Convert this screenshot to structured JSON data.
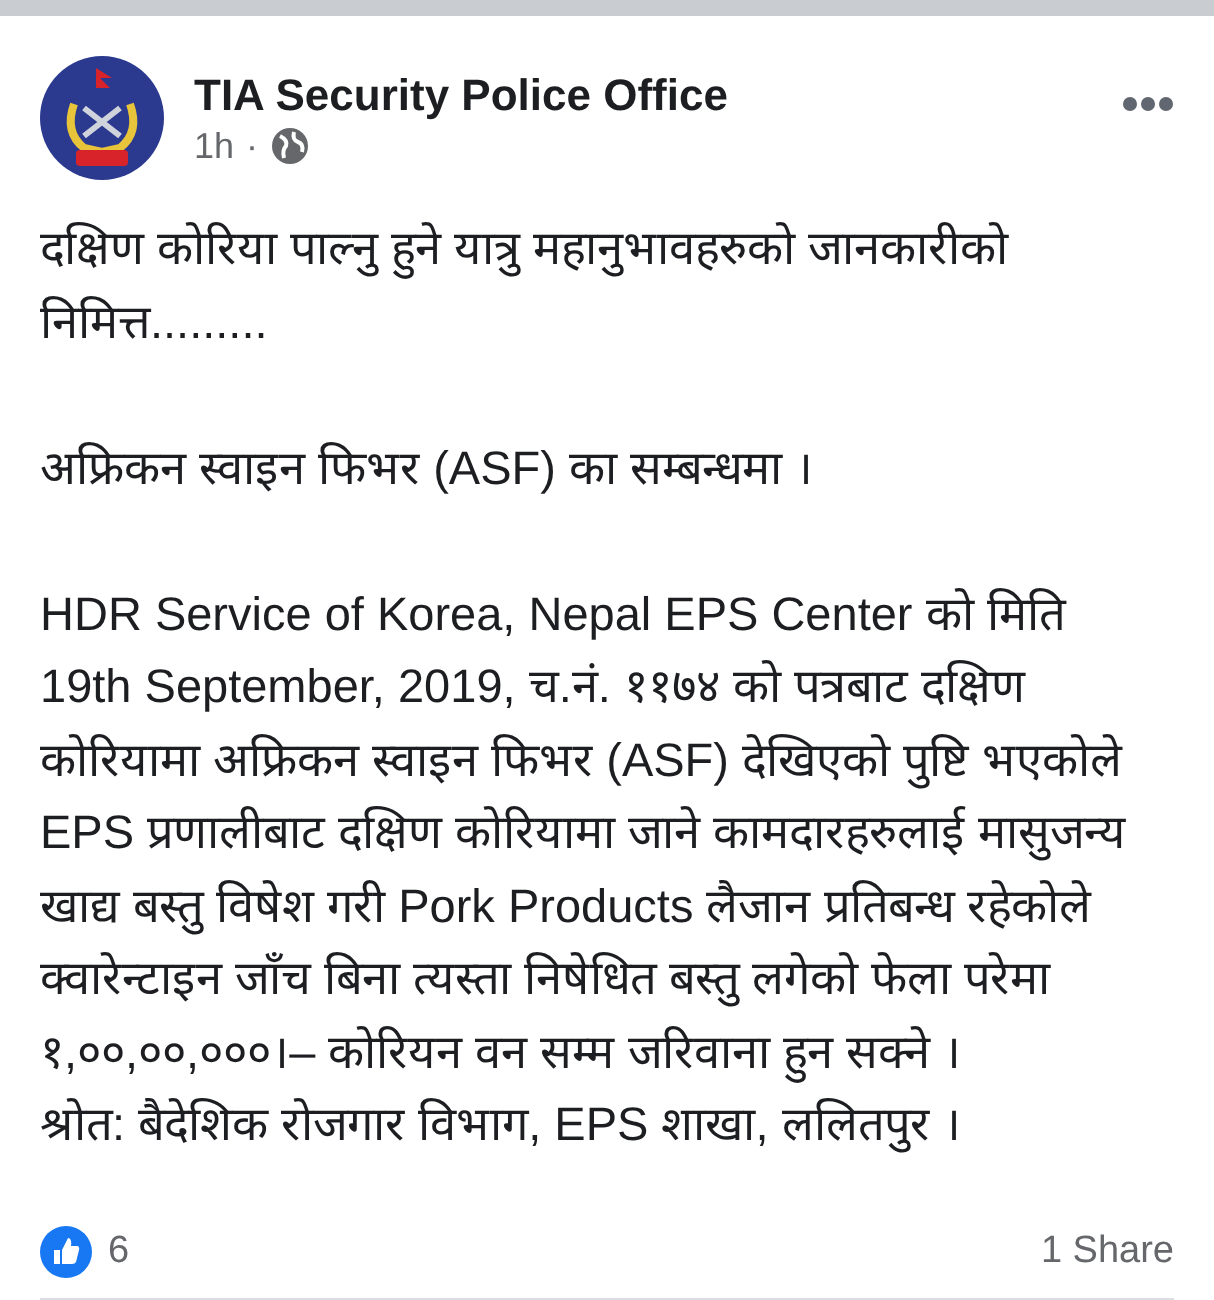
{
  "post": {
    "author": "TIA Security Police Office",
    "time": "1h",
    "separator": "·",
    "paragraphs": [
      [
        "दक्षिण कोरिया पाल्नु हुने यात्रु महानुभावहरुको जानकारीको",
        "निमित्त........."
      ],
      [
        "अफ्रिकन स्वाइन फिभर (ASF) का सम्बन्धमा ।"
      ],
      [
        "HDR Service of Korea, Nepal EPS Center को मिति",
        "19th September, 2019, च.नं. ११७४ को पत्रबाट दक्षिण",
        "कोरियामा अफ्रिकन स्वाइन फिभर (ASF) देखिएको पुष्टि भएकोले",
        "EPS प्रणालीबाट दक्षिण कोरियामा जाने कामदारहरुलाई मासुजन्य",
        "खाद्य बस्तु विषेश गरी Pork Products लैजान प्रतिबन्ध रहेकोले",
        "क्वारेन्टाइन जाँच बिना त्यस्ता निषेधित बस्तु लगेको फेला परेमा",
        "१,००,००,०००।– कोरियन वन सम्म जरिवाना हुन सक्ने ।",
        "श्रोत: बैदेशिक रोजगार विभाग, EPS शाखा, ललितपुर ।"
      ]
    ],
    "likes": "6",
    "shares": "1 Share"
  }
}
